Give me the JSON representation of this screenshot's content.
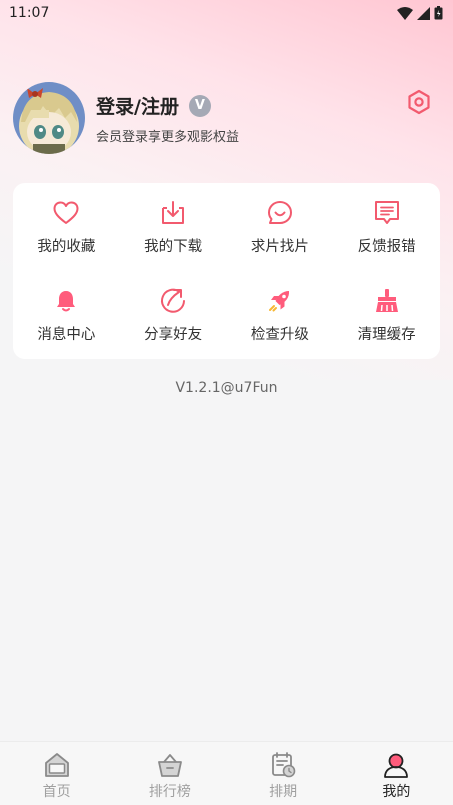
{
  "status_bar": {
    "time": "11:07"
  },
  "profile": {
    "title": "登录/注册",
    "badge": "V",
    "subtitle": "会员登录享更多观影权益"
  },
  "menu": {
    "items": [
      {
        "label": "我的收藏",
        "icon": "heart-icon"
      },
      {
        "label": "我的下载",
        "icon": "download-icon"
      },
      {
        "label": "求片找片",
        "icon": "chat-smile-icon"
      },
      {
        "label": "反馈报错",
        "icon": "feedback-icon"
      },
      {
        "label": "消息中心",
        "icon": "bell-icon"
      },
      {
        "label": "分享好友",
        "icon": "share-icon"
      },
      {
        "label": "检查升级",
        "icon": "rocket-icon"
      },
      {
        "label": "清理缓存",
        "icon": "broom-icon"
      }
    ]
  },
  "version": "V1.2.1@u7Fun",
  "tabs": [
    {
      "label": "首页",
      "icon": "home-icon",
      "active": false
    },
    {
      "label": "排行榜",
      "icon": "ranking-icon",
      "active": false
    },
    {
      "label": "排期",
      "icon": "schedule-icon",
      "active": false
    },
    {
      "label": "我的",
      "icon": "profile-icon",
      "active": true
    }
  ],
  "colors": {
    "accent": "#f25a6e",
    "accent_fill": "#ff5c7c",
    "tab_inactive": "#a0a0a0",
    "tab_active": "#222222"
  }
}
